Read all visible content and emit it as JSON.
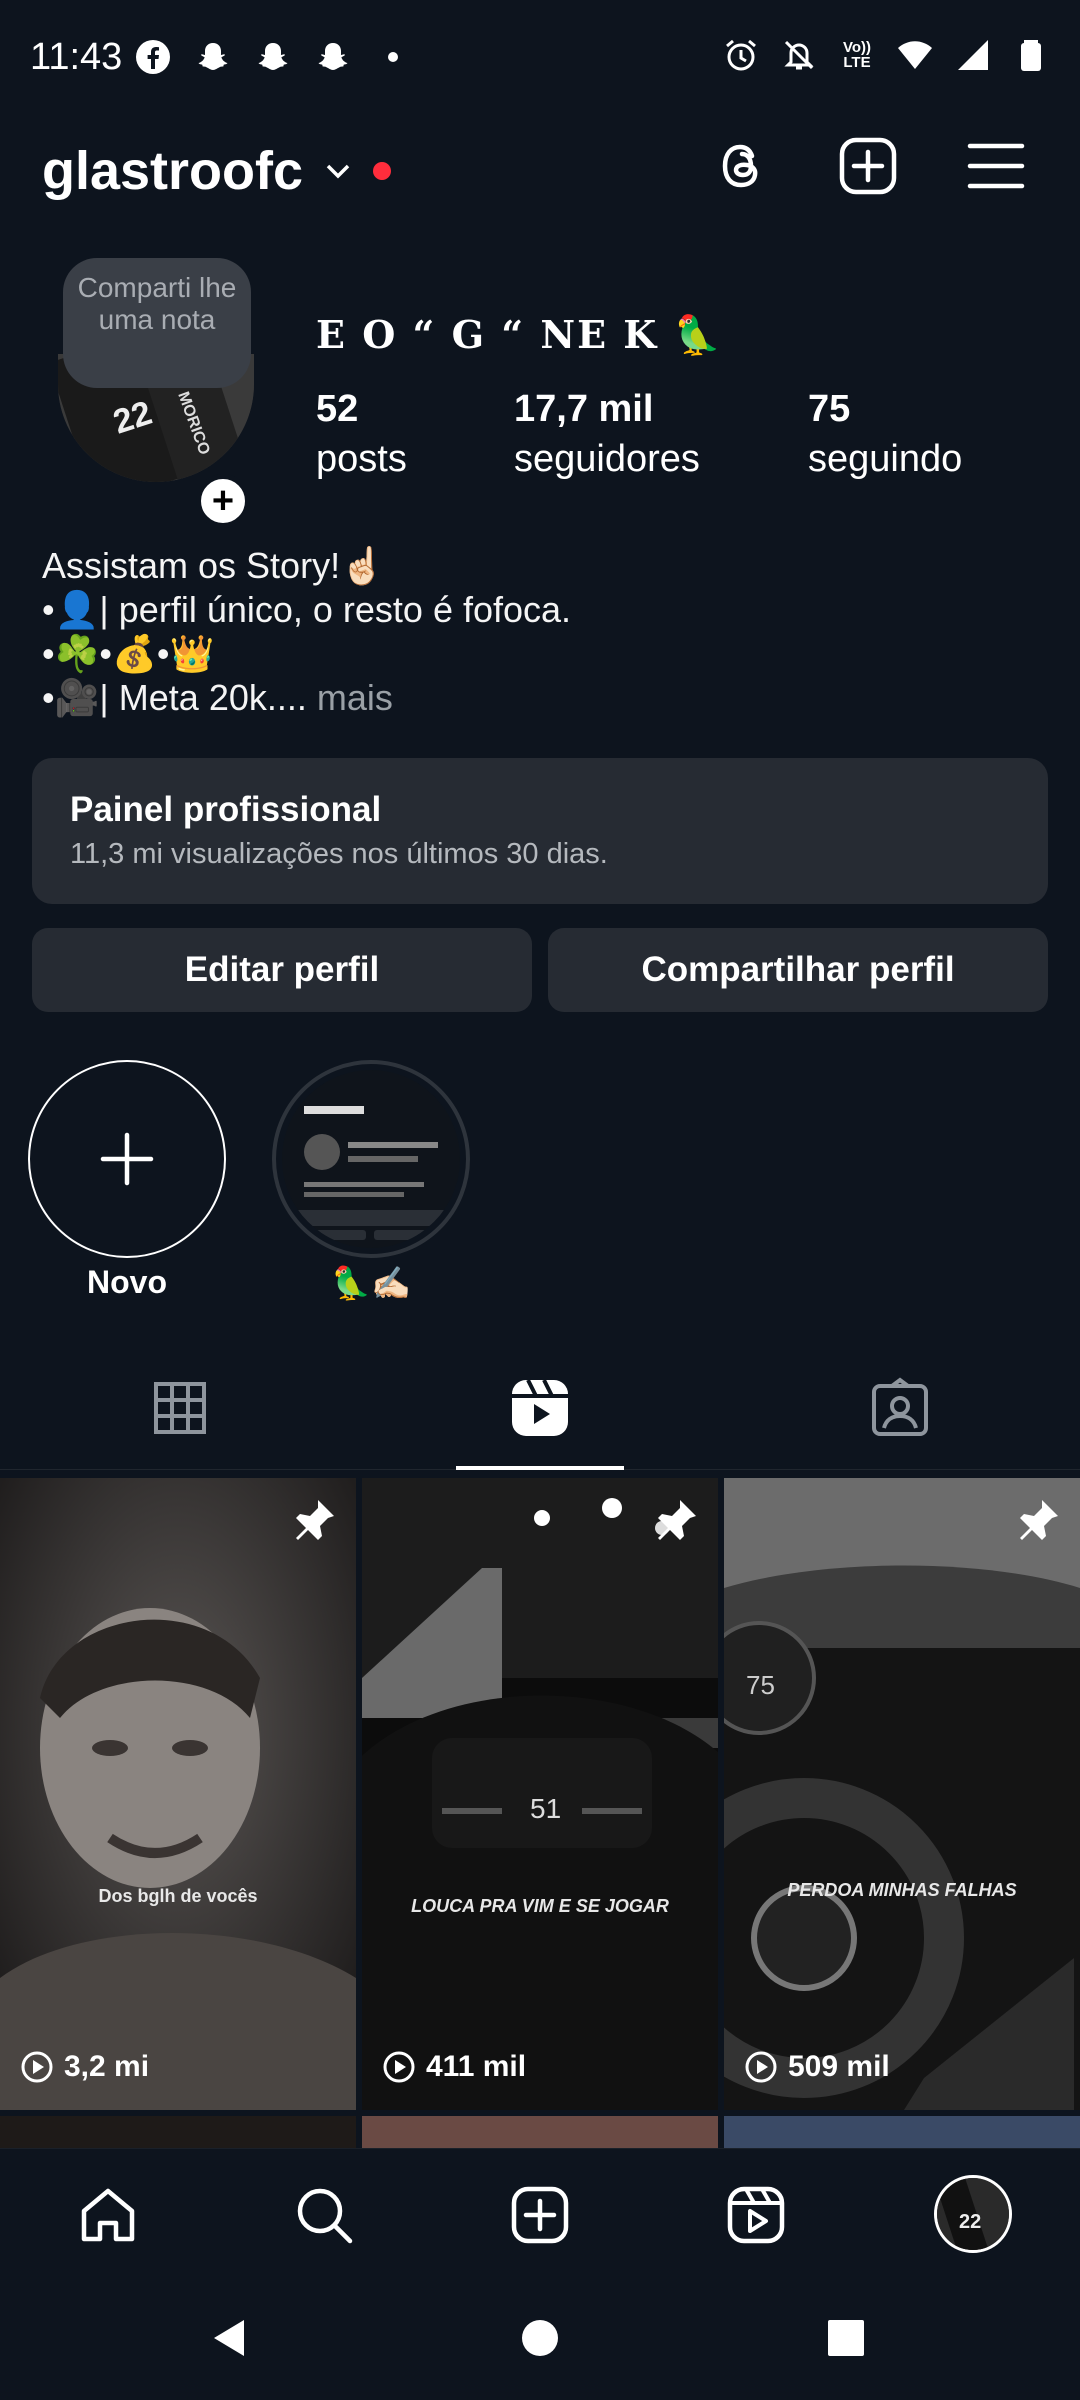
{
  "status_bar": {
    "time": "11:43",
    "left_icons": [
      "facebook-icon",
      "snapchat-icon",
      "snapchat-icon",
      "snapchat-icon",
      "more-dot-icon"
    ],
    "right_icons": [
      "alarm-icon",
      "silent-icon",
      "volte-icon",
      "wifi-icon",
      "signal-icon",
      "battery-icon"
    ],
    "volte_label_1": "Vo))",
    "volte_label_2": "LTE"
  },
  "header": {
    "username": "glastroofc",
    "notification_color": "#ff2d3c"
  },
  "profile": {
    "note_text": "Comparti lhe uma nota",
    "display_name": "E O “ G “ NE K 🦜",
    "stats": [
      {
        "number": "52",
        "label": "posts"
      },
      {
        "number": "17,7 mil",
        "label": "seguidores"
      },
      {
        "number": "75",
        "label": "seguindo"
      }
    ],
    "bio": [
      "Assistam os Story!☝🏻",
      "•👤| perfil único, o resto é fofoca.",
      "•☘️•💰•👑",
      "•🎥| Meta 20k...."
    ],
    "bio_more": " mais"
  },
  "panel": {
    "title": "Painel profissional",
    "subtitle": "11,3 mi visualizações nos últimos 30 dias."
  },
  "buttons": {
    "edit": "Editar perfil",
    "share": "Compartilhar perfil"
  },
  "highlights": [
    {
      "label": "Novo"
    },
    {
      "label": "🦜✍🏻"
    }
  ],
  "tabs": [
    "grid-icon",
    "reels-icon",
    "tagged-icon"
  ],
  "active_tab": "reels",
  "reels": [
    {
      "caption": "Dos bglh de vocês",
      "views": "3,2 mi",
      "pinned": true
    },
    {
      "caption": "LOUCA PRA VIM E SE JOGAR",
      "views": "411 mil",
      "pinned": true
    },
    {
      "caption": "PERDOA MINHAS FALHAS",
      "views": "509 mil",
      "pinned": true
    }
  ],
  "bottom_nav": [
    "home-icon",
    "search-icon",
    "create-icon",
    "reels-icon",
    "profile-avatar"
  ]
}
